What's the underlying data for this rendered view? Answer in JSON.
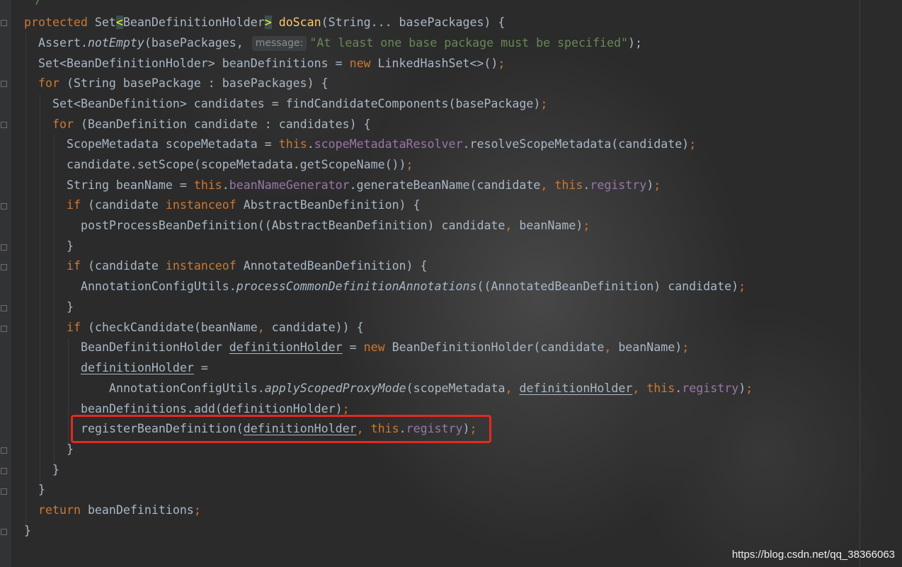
{
  "editor": {
    "comment_end": "*/",
    "lines": {
      "l1": {
        "kw": "protected ",
        "type": "Set",
        "lt": "<",
        "generic": "BeanDefinitionHolder",
        "gt": ">",
        "method": "doScan",
        "params": "(String... basePackages) {"
      },
      "l2": {
        "pre": "Assert.",
        "method": "notEmpty",
        "args": "(basePackages,",
        "hint": "message:",
        "string": "\"At least one base package must be specified\"",
        "post": ");"
      },
      "l3": {
        "pre": "Set<BeanDefinitionHolder> beanDefinitions = ",
        "kw": "new",
        "post": " LinkedHashSet<>()",
        "semi": ";"
      },
      "l4": {
        "kw": "for",
        "post": " (String basePackage : basePackages) {"
      },
      "l5": {
        "pre": "Set<BeanDefinition> candidates = findCandidateComponents(basePackage)",
        "semi": ";"
      },
      "l6": {
        "kw": "for",
        "post": " (BeanDefinition candidate : candidates) {"
      },
      "l7": {
        "pre": "ScopeMetadata scopeMetadata = ",
        "this": "this",
        "dot": ".",
        "field": "scopeMetadataResolver",
        "post": ".resolveScopeMetadata(candidate)",
        "semi": ";"
      },
      "l8": {
        "pre": "candidate.setScope(scopeMetadata.getScopeName())",
        "semi": ";"
      },
      "l9": {
        "pre": "String beanName = ",
        "this": "this",
        "dot": ".",
        "field": "beanNameGenerator",
        "mid": ".generateBeanName(candidate",
        "comma": ", ",
        "this2": "this",
        "dot2": ".",
        "field2": "registry",
        "post": ")",
        "semi": ";"
      },
      "l10": {
        "kw": "if",
        "pre": " (candidate ",
        "kw2": "instanceof",
        "post": " AbstractBeanDefinition) {"
      },
      "l11": {
        "pre": "postProcessBeanDefinition((AbstractBeanDefinition) candidate",
        "comma": ", ",
        "post": "beanName)",
        "semi": ";"
      },
      "l12": {
        "text": "}"
      },
      "l13": {
        "kw": "if",
        "pre": " (candidate ",
        "kw2": "instanceof",
        "post": " AnnotatedBeanDefinition) {"
      },
      "l14": {
        "pre": "AnnotationConfigUtils.",
        "method": "processCommonDefinitionAnnotations",
        "post": "((AnnotatedBeanDefinition) candidate)",
        "semi": ";"
      },
      "l15": {
        "text": "}"
      },
      "l16": {
        "kw": "if",
        "pre": " (checkCandidate(beanName",
        "comma": ", ",
        "post": "candidate)) {"
      },
      "l17": {
        "pre": "BeanDefinitionHolder ",
        "var": "definitionHolder",
        "mid": " = ",
        "kw": "new",
        "post": " BeanDefinitionHolder(candidate",
        "comma": ", ",
        "post2": "beanName)",
        "semi": ";"
      },
      "l18": {
        "var": "definitionHolder",
        "post": " ="
      },
      "l19": {
        "pre": "AnnotationConfigUtils.",
        "method": "applyScopedProxyMode",
        "args": "(scopeMetadata",
        "comma": ", ",
        "var": "definitionHolder",
        "comma2": ", ",
        "this": "this",
        "dot": ".",
        "field": "registry",
        "post": ")",
        "semi": ";"
      },
      "l20": {
        "pre": "beanDefinitions.add(definitionHolder)",
        "semi": ";"
      },
      "l21": {
        "pre": "registerBeanDefinition(",
        "var": "definitionHolder",
        "comma": ", ",
        "this": "this",
        "dot": ".",
        "field": "registry",
        "post": ")",
        "semi": ";"
      },
      "l22": {
        "text": "}"
      },
      "l23": {
        "text": "}"
      },
      "l24": {
        "text": "}"
      },
      "l25": {
        "kw": "return",
        "post": " beanDefinitions",
        "semi": ";"
      },
      "l26": {
        "text": "}"
      }
    }
  },
  "watermark": "https://blog.csdn.net/qq_38366063",
  "colors": {
    "background": "#2b2b2b",
    "keyword": "#cc7832",
    "string": "#6a8759",
    "field": "#9876aa",
    "method_decl": "#ffc66d",
    "default_text": "#a9b7c6",
    "highlight_box": "#e12a24"
  }
}
